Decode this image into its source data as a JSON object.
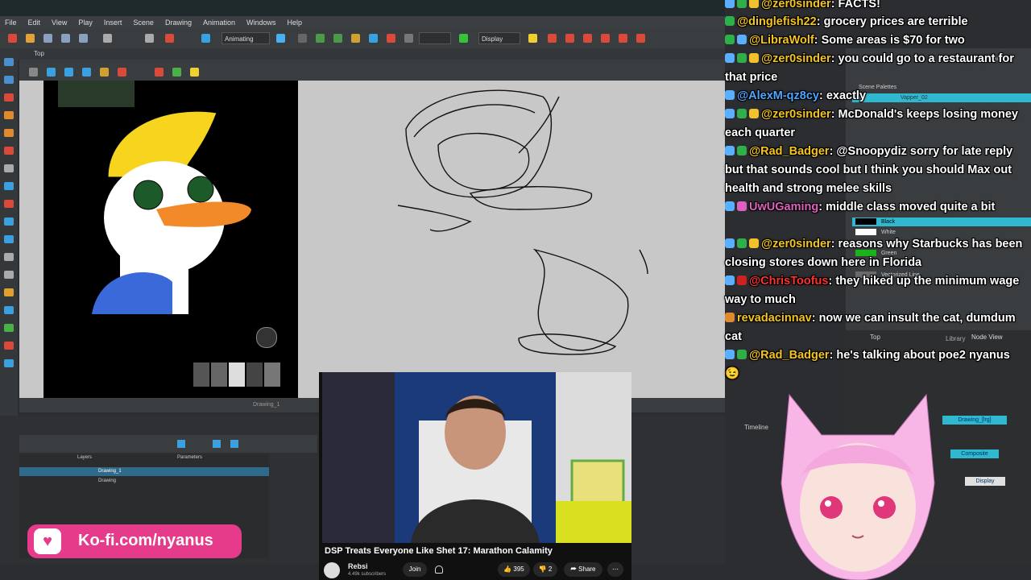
{
  "app": {
    "menu": [
      "File",
      "Edit",
      "View",
      "Play",
      "Insert",
      "Scene",
      "Drawing",
      "Animation",
      "Windows",
      "Help"
    ],
    "mode_dropdown": "Animating",
    "display_dropdown": "Display",
    "view_tab": "Top",
    "statusbar": "Drawing_1"
  },
  "timeline": {
    "tab_label": "Timeline",
    "columns": [
      "Layers",
      "Parameters"
    ],
    "layers": [
      {
        "name": "Drawing_1",
        "selected": true
      },
      {
        "name": "Drawing",
        "selected": false
      }
    ]
  },
  "right_panel": {
    "tabs": [
      "Library"
    ],
    "header": "Scene Palettes",
    "palette_selected": "Vapper_02",
    "colors": [
      {
        "name": "Black",
        "hex": "#000000"
      },
      {
        "name": "White",
        "hex": "#ffffff"
      },
      {
        "name": "Green",
        "hex": "#1bb31b"
      },
      {
        "name": "Vectorized Line",
        "hex": "#6a6a6a"
      }
    ],
    "node_view": {
      "tabs": [
        "Top",
        "Library",
        "Node View"
      ],
      "nodes": [
        "Drawing_[lrg]",
        "Composite",
        "Display"
      ]
    }
  },
  "chat": [
    {
      "user": "@zer0sinder",
      "color": "#f5c518",
      "text": "FACTS!",
      "badges": [
        "wrench",
        "star",
        "yt"
      ]
    },
    {
      "user": "@dinglefish22",
      "color": "#f5c518",
      "text": "grocery prices are terrible",
      "badges": [
        "yt"
      ]
    },
    {
      "user": "@LibraWolf",
      "color": "#f5c518",
      "text": "Some areas is $70 for two",
      "badges": [
        "star",
        "tw"
      ]
    },
    {
      "user": "@zer0sinder",
      "color": "#f5c518",
      "text": "you could go to a restaurant for that price",
      "badges": [
        "wrench",
        "star",
        "yt"
      ]
    },
    {
      "user": "@AlexM-qz8cy",
      "color": "#4da6ff",
      "text": "exactly",
      "badges": [
        "tw"
      ]
    },
    {
      "user": "@zer0sinder",
      "color": "#f5c518",
      "text": "McDonald's keeps losing money each quarter",
      "badges": [
        "wrench",
        "star",
        "yt"
      ]
    },
    {
      "user": "@Rad_Badger",
      "color": "#f5c518",
      "text": "@Snoopydiz sorry for late reply but that sounds cool but I think you should Max out health and strong melee skills",
      "badges": [
        "wrench",
        "yt"
      ]
    },
    {
      "user": "UwUGaming",
      "color": "#e060c0",
      "text": "middle class moved quite a bit",
      "badges": [
        "wrench",
        "k"
      ]
    },
    {
      "user": "@zer0sinder",
      "color": "#f5c518",
      "text": "reasons why Starbucks has been closing stores down here in Florida",
      "badges": [
        "wrench",
        "star",
        "yt"
      ]
    },
    {
      "user": "@ChrisToofus",
      "color": "#ff3030",
      "text": "they hiked up the minimum wage way to much",
      "badges": [
        "tw",
        "yt"
      ]
    },
    {
      "user": "revadacinnav",
      "color": "#f5c518",
      "text": "now we can insult the cat, dumdum cat",
      "badges": [
        "k"
      ]
    },
    {
      "user": "@Rad_Badger",
      "color": "#f5c518",
      "text": "he's talking about poe2 nyanus 😉",
      "badges": [
        "wrench",
        "yt"
      ]
    }
  ],
  "video": {
    "title": "DSP Treats Everyone Like Shet 17: Marathon Calamity",
    "channel": "Rebsi",
    "subscribers": "4.49k subscribers",
    "join_label": "Join",
    "likes": "395",
    "dislikes": "2",
    "share_label": "Share"
  },
  "kofi": {
    "label": "Ko-fi.com/nyanus"
  },
  "colors": {
    "accent": "#e63a8a",
    "chat_name": "#f5c518",
    "panel": "#3a3d40"
  }
}
